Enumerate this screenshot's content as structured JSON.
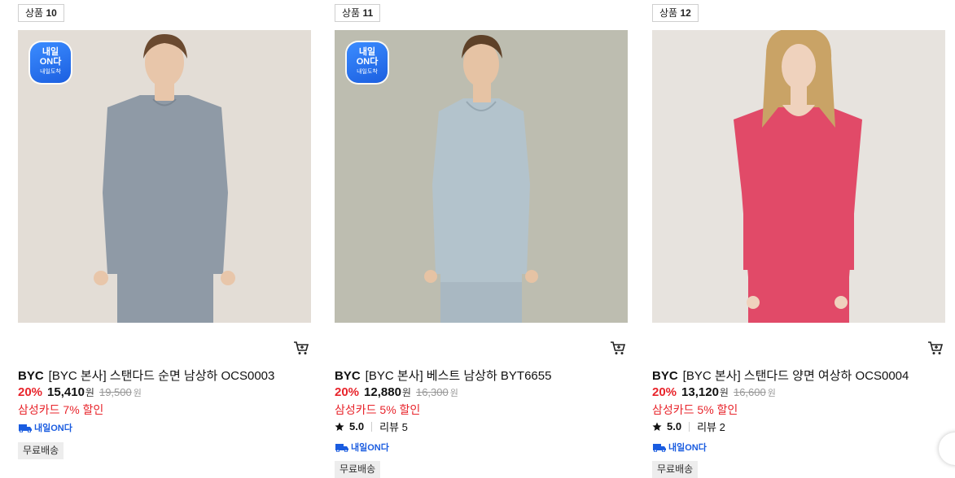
{
  "products": [
    {
      "no_label": "상품",
      "no_value": "10",
      "brand": "BYC",
      "name": "[BYC 본사] 스탠다드 순면 남상하 OCS0003",
      "discount_rate": "20%",
      "price": "15,410",
      "price_unit": "원",
      "original_price": "19,500",
      "original_unit": "원",
      "card_discount": "삼성카드 7% 할인",
      "onda_badge": {
        "line1": "내일",
        "line2": "ON다",
        "line3": "내일도착"
      },
      "onda_logo": "내일ON다",
      "free_shipping": "무료배송",
      "image": {
        "bg": "#e3ddd6",
        "shirt": "#8f9aa6",
        "pants": "#8f9aa6",
        "skin": "#e8c6aa",
        "hair": "#6b4a30"
      }
    },
    {
      "no_label": "상품",
      "no_value": "11",
      "brand": "BYC",
      "name": "[BYC 본사] 베스트 남상하 BYT6655",
      "discount_rate": "20%",
      "price": "12,880",
      "price_unit": "원",
      "original_price": "16,300",
      "original_unit": "원",
      "card_discount": "삼성카드 5% 할인",
      "rating": "5.0",
      "reviews": "리뷰 5",
      "onda_badge": {
        "line1": "내일",
        "line2": "ON다",
        "line3": "내일도착"
      },
      "onda_logo": "내일ON다",
      "free_shipping": "무료배송",
      "image": {
        "bg": "#bdbdb0",
        "shirt": "#b3c3cc",
        "pants": "#a9b8c2",
        "skin": "#e6c3a4",
        "hair": "#5e4128"
      }
    },
    {
      "no_label": "상품",
      "no_value": "12",
      "brand": "BYC",
      "name": "[BYC 본사] 스탠다드 양면 여상하 OCS0004",
      "discount_rate": "20%",
      "price": "13,120",
      "price_unit": "원",
      "original_price": "16,600",
      "original_unit": "원",
      "card_discount": "삼성카드 5% 할인",
      "rating": "5.0",
      "reviews": "리뷰 2",
      "onda_logo": "내일ON다",
      "free_shipping": "무료배송",
      "image": {
        "bg": "#e7e3de",
        "shirt": "#e14a68",
        "pants": "#e14a68",
        "skin": "#efd2bd",
        "hair": "#c9a366"
      }
    }
  ],
  "colors": {
    "accent_red": "#e8242b",
    "onda_blue": "#1a5ce0"
  }
}
